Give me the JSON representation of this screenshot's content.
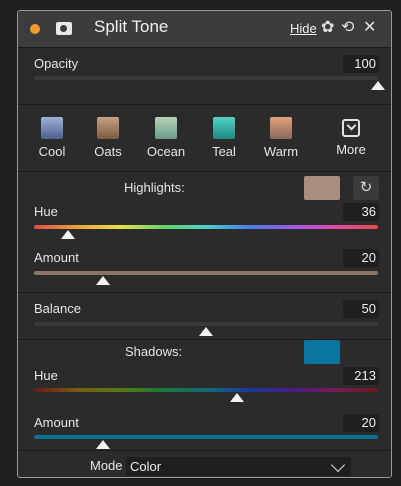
{
  "header": {
    "title": "Split Tone",
    "hide_label": "Hide",
    "accent_color": "#f39a2c",
    "icons": [
      "mask-icon",
      "gear-icon",
      "undo-icon",
      "close-icon"
    ]
  },
  "opacity": {
    "label": "Opacity",
    "value": "100",
    "level": 1.0
  },
  "presets": [
    {
      "label": "Cool",
      "color_top": "#9fb2d6",
      "color_bottom": "#4c5d8f"
    },
    {
      "label": "Oats",
      "color_top": "#c9a283",
      "color_bottom": "#7a5a3e"
    },
    {
      "label": "Ocean",
      "color_top": "#b7d4b3",
      "color_bottom": "#6a9a8a"
    },
    {
      "label": "Teal",
      "color_top": "#54d2c2",
      "color_bottom": "#1f8a86"
    },
    {
      "label": "Warm",
      "color_top": "#e3a073",
      "color_bottom": "#8a6a63"
    }
  ],
  "more": {
    "label": "More"
  },
  "highlights": {
    "title": "Highlights:",
    "swatch_color": "#a88f80",
    "hue": {
      "label": "Hue",
      "value": "36",
      "level": 0.1
    },
    "amount": {
      "label": "Amount",
      "value": "20",
      "level": 0.2,
      "color": "#8c7568"
    }
  },
  "balance": {
    "label": "Balance",
    "value": "50",
    "level": 0.5
  },
  "shadows": {
    "title": "Shadows:",
    "swatch_color": "#0a76a0",
    "hue": {
      "label": "Hue",
      "value": "213",
      "level": 0.59
    },
    "amount": {
      "label": "Amount",
      "value": "20",
      "level": 0.2,
      "color": "#0b6f98"
    }
  },
  "mode": {
    "label": "Mode",
    "value": "Color"
  }
}
